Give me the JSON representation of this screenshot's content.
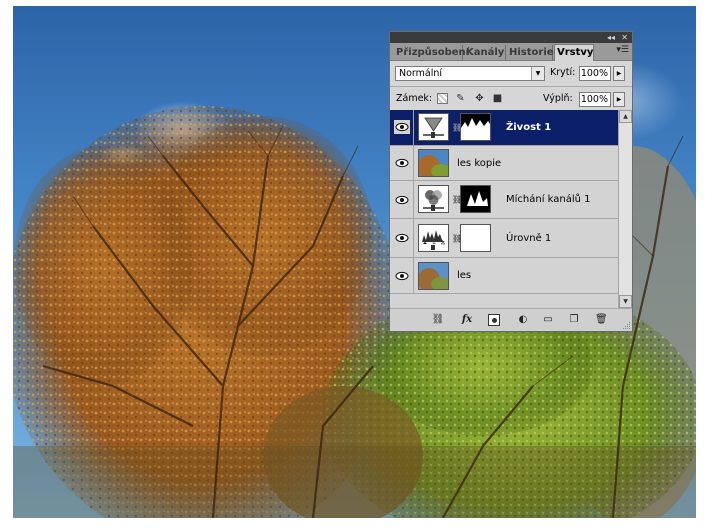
{
  "panel": {
    "tabs": [
      {
        "label": "Přizpůsobení",
        "active": false
      },
      {
        "label": "Kanály",
        "active": false
      },
      {
        "label": "Historie",
        "active": false
      },
      {
        "label": "Vrstvy",
        "active": true
      }
    ],
    "titlebar_icons": [
      "collapse-icon",
      "close-icon"
    ],
    "blend_mode": "Normální",
    "opacity_label": "Krytí:",
    "opacity_value": "100%",
    "lock_label": "Zámek:",
    "fill_label": "Výplň:",
    "fill_value": "100%",
    "lock_icons": [
      "lock-transparent-icon",
      "lock-paint-icon",
      "lock-move-icon",
      "lock-all-icon"
    ],
    "layers": [
      {
        "name": "Živost 1",
        "selected": true,
        "type": "vibrance-adjustment",
        "has_mask": true
      },
      {
        "name": "les kopie",
        "selected": false,
        "type": "image",
        "has_mask": false
      },
      {
        "name": "Míchání kanálů 1",
        "selected": false,
        "type": "channel-mixer-adjustment",
        "has_mask": true
      },
      {
        "name": "Úrovně 1",
        "selected": false,
        "type": "levels-adjustment",
        "has_mask": true
      },
      {
        "name": "les",
        "selected": false,
        "type": "image",
        "has_mask": false
      }
    ],
    "footer_icons": [
      "link-layers-icon",
      "fx-icon",
      "add-mask-icon",
      "adjustment-layer-icon",
      "new-group-icon",
      "new-layer-icon",
      "delete-layer-icon"
    ],
    "footer_fx_label": "fx"
  },
  "colors": {
    "selection": "#0b2069",
    "panel_bg": "#d6d6d6",
    "titlebar": "#3b3b3b"
  }
}
